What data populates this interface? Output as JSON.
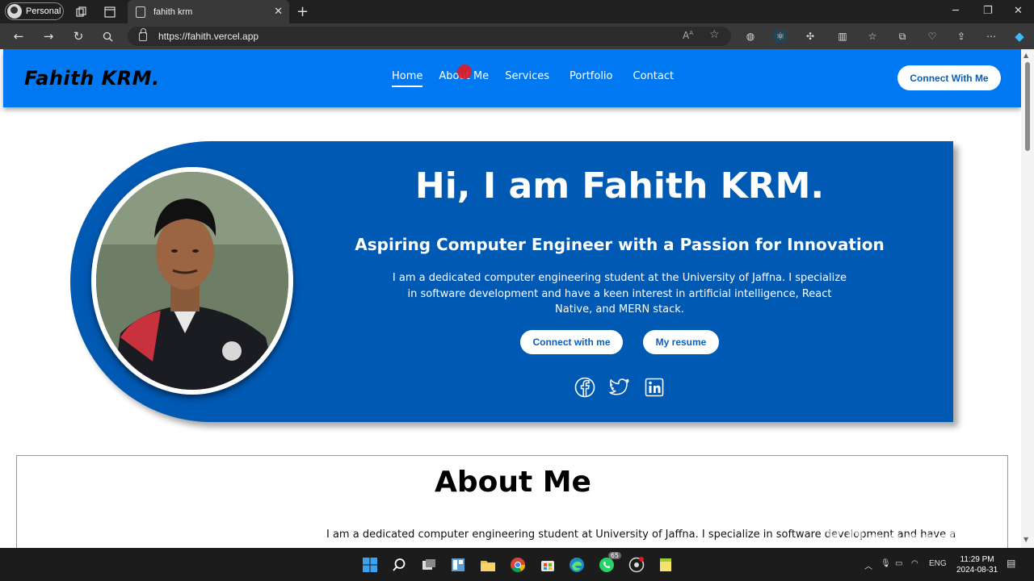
{
  "browser": {
    "profile_label": "Personal",
    "tab_title": "fahith krm",
    "url": "https://fahith.vercel.app"
  },
  "site": {
    "logo": "Fahith KRM.",
    "nav": [
      "Home",
      "About Me",
      "Services",
      "Portfolio",
      "Contact"
    ],
    "cta": "Connect With Me"
  },
  "hero": {
    "title": "Hi, I am Fahith KRM.",
    "subtitle": "Aspiring Computer Engineer with a Passion for Innovation",
    "description": "I am a dedicated computer engineering student at the University of Jaffna. I specialize in software development and have a keen interest in artificial intelligence, React Native, and MERN stack.",
    "btn_connect": "Connect with me",
    "btn_resume": "My resume",
    "socials": [
      "facebook-icon",
      "twitter-icon",
      "linkedin-icon"
    ]
  },
  "about": {
    "title": "About Me",
    "text": "I am a dedicated computer engineering student at University of Jaffna. I specialize in software development and have a"
  },
  "watermark": "XRecorder",
  "taskbar": {
    "whatsapp_badge": "65",
    "lang": "ENG",
    "time": "11:29 PM",
    "date": "2024-08-31"
  },
  "colors": {
    "header_blue": "#0078f2",
    "hero_blue": "#0059b3",
    "button_text": "#0a5fb8"
  }
}
